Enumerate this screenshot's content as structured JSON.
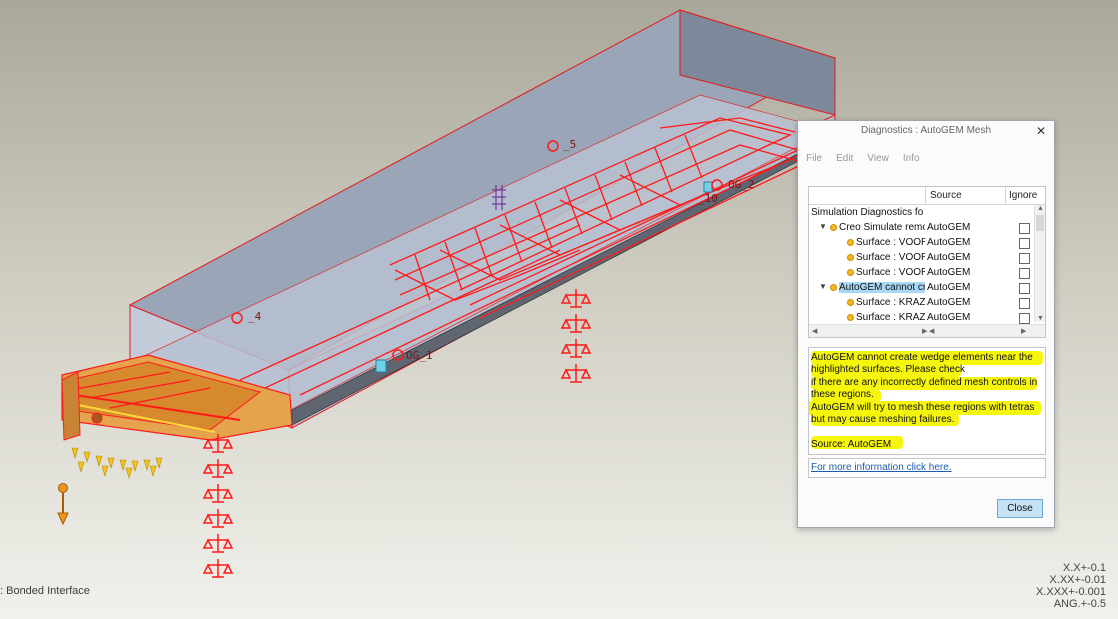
{
  "scene": {
    "labels": [
      "_5",
      "_4",
      "OG_1",
      "OG_2",
      "_10"
    ],
    "status_left": ": Bonded Interface",
    "tolerances": [
      "X.X+-0.1",
      "X.XX+-0.01",
      "X.XXX+-0.001",
      "ANG.+-0.5"
    ],
    "colors": {
      "mesh": "#ff1a1a",
      "body": "#a6b0c3",
      "constraint": "#e08a1c"
    }
  },
  "dialog": {
    "title": "Diagnostics : AutoGEM Mesh",
    "menu": [
      "File",
      "Edit",
      "View",
      "Info"
    ],
    "columns": {
      "source": "Source",
      "ignore": "Ignore"
    },
    "rows": [
      {
        "name": "Simulation Diagnostics fo",
        "source": "",
        "level": 0,
        "dot": false,
        "expander": false,
        "check": false,
        "highlight": false
      },
      {
        "name": "Creo Simulate remo",
        "source": "AutoGEM",
        "level": 1,
        "dot": true,
        "expander": true,
        "check": true,
        "highlight": false
      },
      {
        "name": "Surface : VOORE",
        "source": "AutoGEM",
        "level": 2,
        "dot": true,
        "expander": false,
        "check": true,
        "highlight": false
      },
      {
        "name": "Surface : VOORE",
        "source": "AutoGEM",
        "level": 2,
        "dot": true,
        "expander": false,
        "check": true,
        "highlight": false
      },
      {
        "name": "Surface : VOORE",
        "source": "AutoGEM",
        "level": 2,
        "dot": true,
        "expander": false,
        "check": true,
        "highlight": false
      },
      {
        "name": "AutoGEM cannot cr",
        "source": "AutoGEM",
        "level": 1,
        "dot": true,
        "expander": true,
        "check": true,
        "highlight": true
      },
      {
        "name": "Surface : KRAZE",
        "source": "AutoGEM",
        "level": 2,
        "dot": true,
        "expander": false,
        "check": true,
        "highlight": false
      },
      {
        "name": "Surface : KRAZE",
        "source": "AutoGEM",
        "level": 2,
        "dot": true,
        "expander": false,
        "check": true,
        "highlight": false
      }
    ],
    "message": "AutoGEM cannot create wedge elements near the\nhighlighted surfaces. Please check\nif there are any incorrectly defined mesh controls in\nthese regions.\nAutoGEM will try to mesh these regions with tetras\nbut may cause meshing failures.\n\nSource: AutoGEM",
    "info_link": "For more information click here.",
    "close_label": "Close"
  }
}
